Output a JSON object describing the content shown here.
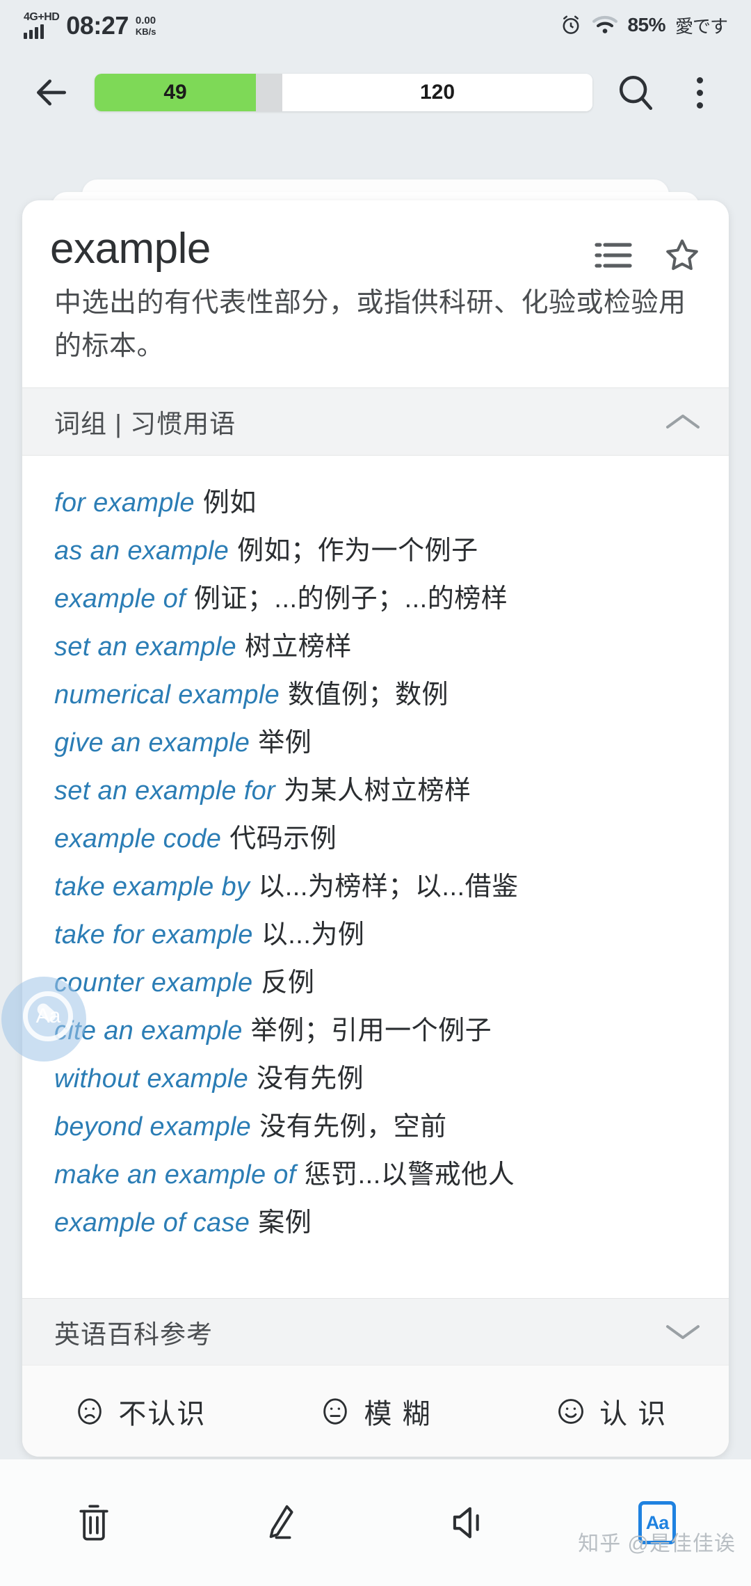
{
  "status_bar": {
    "network_label": "4G+HD",
    "time": "08:27",
    "speed_value": "0.00",
    "speed_unit": "KB/s",
    "battery": "85%",
    "ime_label": "愛です",
    "alarm_icon": "alarm-clock-icon",
    "wifi_icon": "wifi-icon"
  },
  "top_bar": {
    "back_icon": "back-arrow-icon",
    "progress_done": "49",
    "progress_total": "120",
    "search_icon": "search-icon",
    "overflow_icon": "more-vertical-icon"
  },
  "card": {
    "headword": "example",
    "list_icon": "list-icon",
    "star_icon": "star-outline-icon",
    "definition": "中选出的有代表性部分，或指供科研、化验或检验用的标本。",
    "section_phrases": {
      "title": "词组 | 习惯用语",
      "collapse_icon": "chevron-up-icon",
      "items": [
        {
          "en": "for example",
          "zh": "例如"
        },
        {
          "en": "as an example",
          "zh": "例如；作为一个例子"
        },
        {
          "en": "example of",
          "zh": "例证；...的例子；...的榜样"
        },
        {
          "en": "set an example",
          "zh": "树立榜样"
        },
        {
          "en": "numerical example",
          "zh": "数值例；数例"
        },
        {
          "en": "give an example",
          "zh": "举例"
        },
        {
          "en": "set an example for",
          "zh": "为某人树立榜样"
        },
        {
          "en": "example code",
          "zh": "代码示例"
        },
        {
          "en": "take example by",
          "zh": "以...为榜样；以...借鉴"
        },
        {
          "en": "take for example",
          "zh": "以...为例"
        },
        {
          "en": "counter example",
          "zh": "反例"
        },
        {
          "en": "cite an example",
          "zh": "举例；引用一个例子"
        },
        {
          "en": "without example",
          "zh": "没有先例"
        },
        {
          "en": "beyond example",
          "zh": "没有先例，空前"
        },
        {
          "en": "make an example of",
          "zh": "惩罚...以警戒他人"
        },
        {
          "en": "example of case",
          "zh": "案例"
        }
      ]
    },
    "section_encyclopedia": {
      "title": "英语百科参考",
      "collapse_icon": "chevron-down-icon"
    },
    "grade_buttons": [
      {
        "label": "不认识",
        "icon": "frowning-face-icon"
      },
      {
        "label": "模 糊",
        "icon": "neutral-face-icon"
      },
      {
        "label": "认 识",
        "icon": "smiling-face-icon"
      }
    ]
  },
  "floating_bubble": {
    "label": "Aa",
    "icon": "text-magnifier-icon"
  },
  "bottom_bar": {
    "items": [
      {
        "icon": "trash-icon",
        "label": ""
      },
      {
        "icon": "pencil-icon",
        "label": ""
      },
      {
        "icon": "speaker-icon",
        "label": ""
      },
      {
        "icon": "font-size-icon",
        "label": "Aa"
      }
    ]
  },
  "watermark": "知乎 @是佳佳诶",
  "colors": {
    "page_bg": "#e9edf0",
    "card_bg": "#ffffff",
    "progress_green": "#7ed957",
    "phrase_blue": "#2b7db5",
    "accent_blue": "#1f82e0"
  }
}
